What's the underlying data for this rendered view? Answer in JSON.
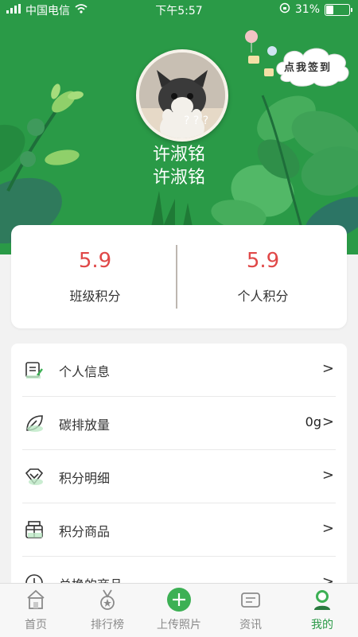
{
  "status_bar": {
    "carrier": "中国电信",
    "time": "下午5:57",
    "battery": "31%"
  },
  "profile": {
    "avatar_caption": "? ? ?",
    "name_line1": "许淑铭",
    "name_line2": "许淑铭",
    "signin_label": "点我签到"
  },
  "scores": [
    {
      "value": "5.9",
      "label": "班级积分"
    },
    {
      "value": "5.9",
      "label": "个人积分"
    }
  ],
  "menu": [
    {
      "label": "个人信息",
      "value": "",
      "icon": "document-icon"
    },
    {
      "label": "碳排放量",
      "value": "0g",
      "icon": "leaf-icon"
    },
    {
      "label": "积分明细",
      "value": "",
      "icon": "diamond-icon"
    },
    {
      "label": "积分商品",
      "value": "",
      "icon": "gift-icon"
    },
    {
      "label": "兑换的商品",
      "value": "",
      "icon": "clock-icon"
    }
  ],
  "tabs": [
    {
      "label": "首页",
      "icon": "home-icon"
    },
    {
      "label": "排行榜",
      "icon": "medal-icon"
    },
    {
      "label": "上传照片",
      "icon": "plus-circle-icon"
    },
    {
      "label": "资讯",
      "icon": "news-icon"
    },
    {
      "label": "我的",
      "icon": "user-icon",
      "active": true
    }
  ],
  "colors": {
    "brand": "#2a9a47",
    "score": "#e04848",
    "inactive": "#8a8a8a"
  }
}
